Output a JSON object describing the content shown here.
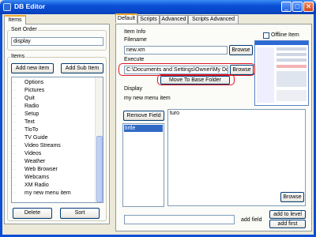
{
  "window": {
    "title": "DB Editor",
    "min_glyph": "_",
    "max_glyph": "□",
    "close_glyph": "✕"
  },
  "left": {
    "tab": "Items",
    "sort_order_label": "Sort Order",
    "sort_order_value": "display",
    "items_group_label": "Items",
    "add_new_item": "Add new item",
    "add_sub_item": "Add Sub Item",
    "tree_items": [
      "Options",
      "Pictures",
      "Quit",
      "Radio",
      "Setup",
      "Text",
      "TloTo",
      "TV Guide",
      "Video Streams",
      "Videos",
      "Weather",
      "Web Browser",
      "Webcams",
      "XM Radio",
      "my new menu item"
    ],
    "delete": "Delete",
    "sort": "Sort"
  },
  "right": {
    "tabs": [
      "Default",
      "Scripts",
      "Advanced",
      "Scripts Advanced"
    ],
    "item_info_label": "Item Info",
    "filename_label": "Filename",
    "filename_value": "new.xm",
    "browse1": "Browse",
    "offline_item": "Offline Item",
    "execute_label": "Execute",
    "execute_value": "C:\\Documents and Settings\\Owner\\My Docum",
    "browse2": "Browse",
    "move_folder": "Move To Base Folder",
    "display_label": "Display",
    "display_value": "my new menu item",
    "remove_field": "Remove Field",
    "field_list": [
      "tirtle"
    ],
    "field_text": "turo",
    "browse3": "Browse",
    "add_field": "add field",
    "add_to_level": "add to level",
    "add_first": "add first"
  }
}
